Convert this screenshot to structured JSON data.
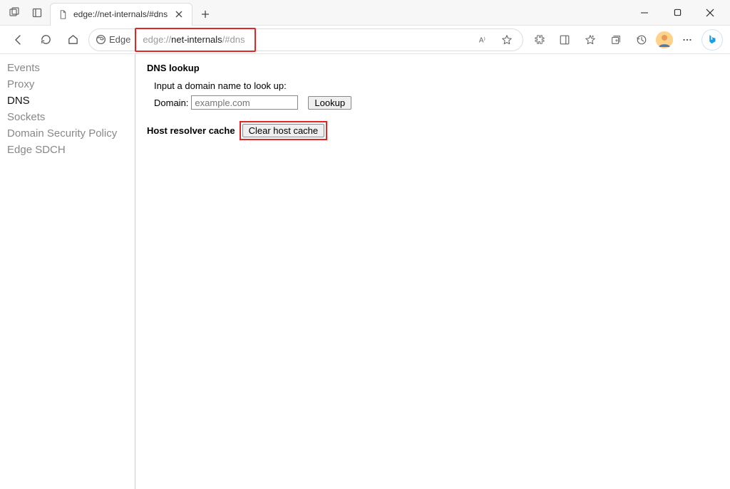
{
  "titlebar": {
    "tab_title": "edge://net-internals/#dns"
  },
  "toolbar": {
    "edge_label": "Edge",
    "url_prefix": "edge://",
    "url_host": "net-internals",
    "url_hash": "/#dns"
  },
  "sidebar": {
    "items": [
      {
        "label": "Events"
      },
      {
        "label": "Proxy"
      },
      {
        "label": "DNS"
      },
      {
        "label": "Sockets"
      },
      {
        "label": "Domain Security Policy"
      },
      {
        "label": "Edge SDCH"
      }
    ]
  },
  "main": {
    "heading": "DNS lookup",
    "instruction": "Input a domain name to look up:",
    "domain_label": "Domain:",
    "domain_placeholder": "example.com",
    "lookup_button": "Lookup",
    "cache_label": "Host resolver cache",
    "clear_button": "Clear host cache"
  }
}
